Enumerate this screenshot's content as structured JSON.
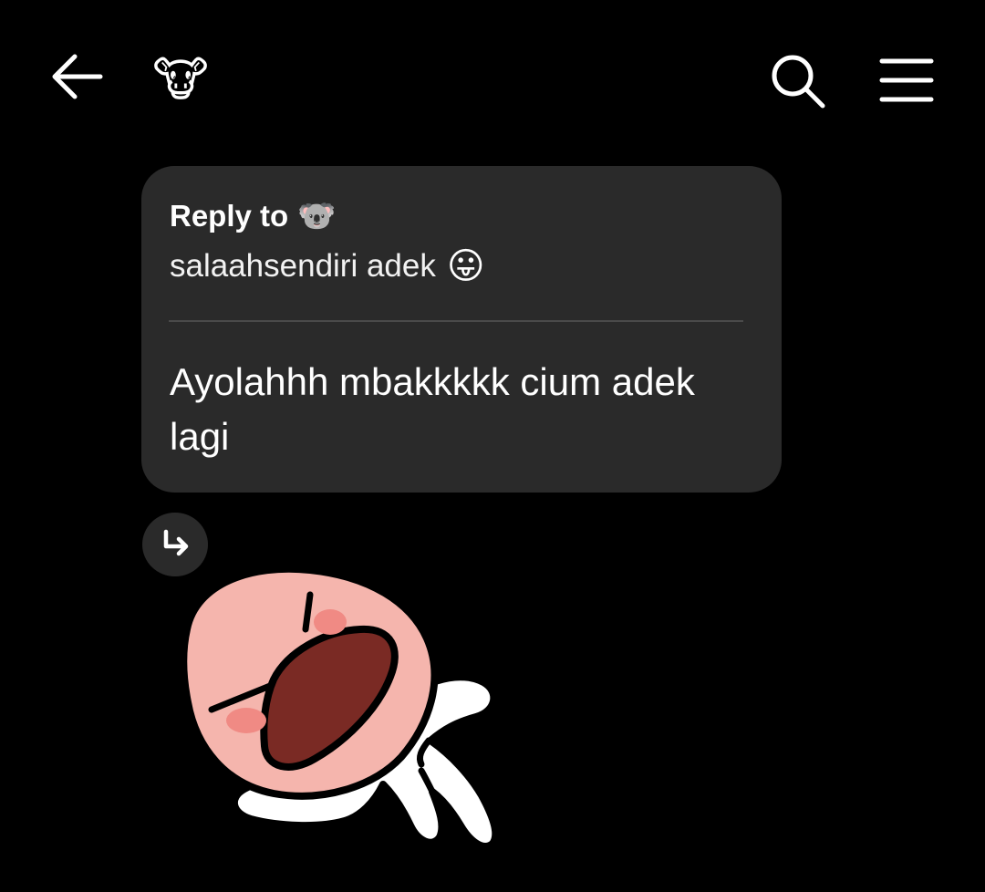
{
  "header": {
    "back_icon": "arrow-left-icon",
    "contact_emoji": "🐮",
    "search_icon": "search-icon",
    "menu_icon": "hamburger-menu-icon"
  },
  "message": {
    "reply_label": "Reply to",
    "reply_to_emoji": "🐨",
    "quoted_text": "salaahsendiri adek",
    "quoted_emoji": "😛",
    "body": "Ayolahhh mbakkkkk cium adek lagi"
  },
  "reply_indicator_icon": "reply-arrow-icon",
  "sticker": {
    "name": "peach-sticker-shouting-pointing"
  },
  "colors": {
    "background": "#000000",
    "bubble": "#2a2a2a",
    "divider": "#4a4a4a",
    "text": "#ffffff"
  }
}
